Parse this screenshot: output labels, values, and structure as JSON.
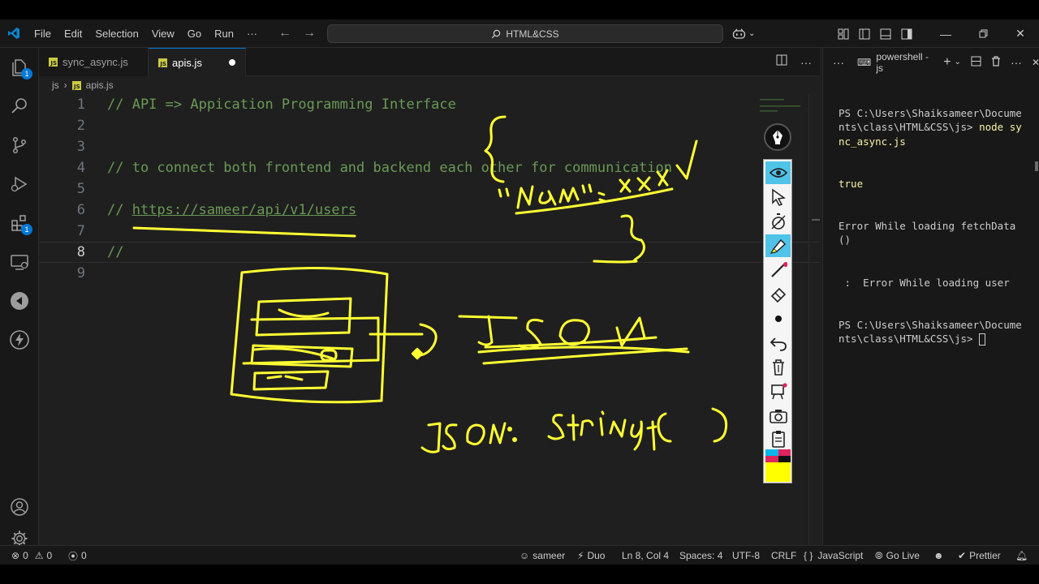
{
  "app": {
    "name": "Visual Studio Code",
    "accent": "#0078d4"
  },
  "menu": [
    "File",
    "Edit",
    "Selection",
    "View",
    "Go",
    "Run",
    "···"
  ],
  "search": {
    "text": "HTML&CSS"
  },
  "tabs": [
    {
      "label": "sync_async.js",
      "active": false
    },
    {
      "label": "apis.js",
      "active": true,
      "modified": true
    }
  ],
  "breadcrumb": {
    "folder": "js",
    "sep": "›",
    "file": "apis.js"
  },
  "activity_badges": {
    "explorer": "1",
    "extensions": "1"
  },
  "editor": {
    "lines": [
      {
        "num": "1",
        "text": "// API => Appication Programming Interface"
      },
      {
        "num": "2",
        "text": ""
      },
      {
        "num": "3",
        "text": ""
      },
      {
        "num": "4",
        "text": "// to connect both frontend and backend each other for communication"
      },
      {
        "num": "5",
        "text": ""
      },
      {
        "num": "6",
        "text": "// ",
        "link": "https://sameer/api/v1/users"
      },
      {
        "num": "7",
        "text": ""
      },
      {
        "num": "8",
        "text": "//",
        "current": true
      },
      {
        "num": "9",
        "text": ""
      }
    ],
    "comment_color": "#6a9955"
  },
  "annotation": {
    "color": "#ffff33",
    "handwriting": [
      "{",
      "\"name\": \"xxx\"",
      "}",
      "JSON",
      "JSON. stringify()"
    ]
  },
  "panel": {
    "tab_label": "powershell - js",
    "terminal": [
      {
        "prefix": "PS C:\\Users\\Shaiksameer\\Documents\\class\\HTML&CSS\\js> ",
        "cmd": "node sync_async.js"
      },
      {
        "prefix": "true",
        "cmd": ""
      },
      {
        "prefix": "Error While loading fetchData()",
        "cmd": ""
      },
      {
        "prefix": " :  Error While loading user",
        "cmd": ""
      },
      {
        "prefix": "PS C:\\Users\\Shaiksameer\\Documents\\class\\HTML&CSS\\js> ",
        "cmd": ""
      }
    ]
  },
  "status": {
    "errors": "0",
    "warnings": "0",
    "ports": "0",
    "user": "sameer",
    "duo": "Duo",
    "position": "Ln 8, Col 4",
    "spaces": "Spaces: 4",
    "encoding": "UTF-8",
    "eol": "CRLF",
    "language": "JavaScript",
    "golive": "Go Live",
    "prettier": "Prettier",
    "braces": "{ }"
  },
  "icons": [
    "vscode-logo-icon",
    "files-icon",
    "search-icon",
    "source-control-icon",
    "run-debug-icon",
    "extensions-icon",
    "remote-explorer-icon",
    "gitlens-icon",
    "thunder-client-icon",
    "account-icon",
    "settings-gear-icon",
    "split-editor-icon",
    "more-icon",
    "terminal-icon",
    "plus-icon",
    "trash-icon",
    "close-icon",
    "copilot-icon",
    "eye-icon",
    "cursor-arrow-icon",
    "timer-icon",
    "highlighter-icon",
    "pen-icon",
    "eraser-icon",
    "dot-icon",
    "undo-icon",
    "clear-icon",
    "whiteboard-icon",
    "camera-icon",
    "clipboard-icon"
  ]
}
